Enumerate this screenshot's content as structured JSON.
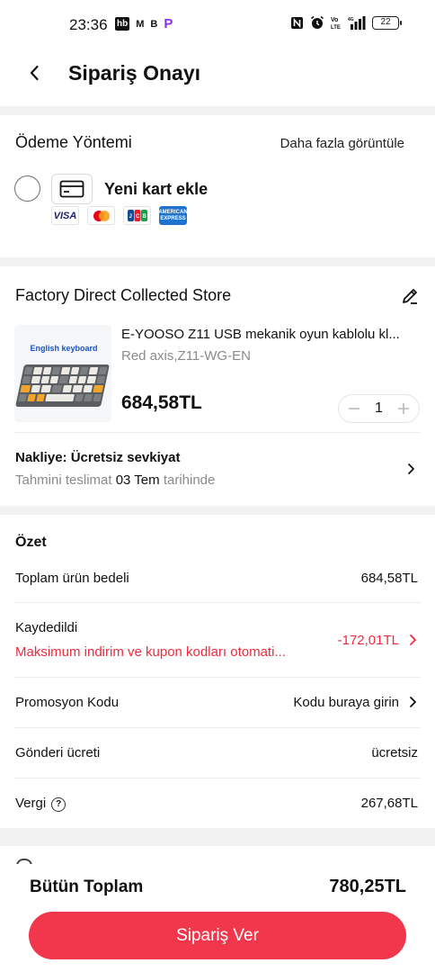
{
  "status_bar": {
    "time": "23:36",
    "left_badges": [
      "hb",
      "M",
      "B",
      "P"
    ],
    "battery": "22"
  },
  "header": {
    "title": "Sipariş Onayı"
  },
  "payment": {
    "title": "Ödeme Yöntemi",
    "more_link": "Daha fazla görüntüle",
    "new_card_label": "Yeni kart ekle",
    "brands": [
      "VISA",
      "mastercard",
      "JCB",
      "AMERICAN EXPRESS"
    ]
  },
  "store": {
    "name": "Factory Direct Collected Store",
    "product": {
      "image_text": "English keyboard",
      "name": "E-YOOSO Z11 USB mekanik oyun kablolu kl...",
      "variant": "Red axis,Z11-WG-EN",
      "price": "684,58TL",
      "quantity": "1"
    },
    "shipping": {
      "title": "Nakliye: Ücretsiz sevkiyat",
      "estimate_prefix": "Tahmini teslimat",
      "estimate_date": "03 Tem",
      "estimate_suffix": "tarihinde"
    }
  },
  "summary": {
    "title": "Özet",
    "rows": {
      "subtotal_label": "Toplam ürün bedeli",
      "subtotal_value": "684,58TL",
      "saved_label": "Kaydedildi",
      "saved_note": "Maksimum indirim ve kupon kodları otomati...",
      "saved_value": "-172,01TL",
      "promo_label": "Promosyon Kodu",
      "promo_value": "Kodu buraya girin",
      "shipping_label": "Gönderi ücreti",
      "shipping_value": "ücretsiz",
      "tax_label": "Vergi",
      "tax_value": "267,68TL"
    }
  },
  "footer": {
    "total_label": "Bütün Toplam",
    "total_value": "780,25TL",
    "order_button": "Sipariş Ver"
  },
  "colors": {
    "accent": "#f2364b",
    "discount": "#f02a3c",
    "muted_text": "#8a8a8a",
    "page_bg": "#f2f2f2"
  }
}
